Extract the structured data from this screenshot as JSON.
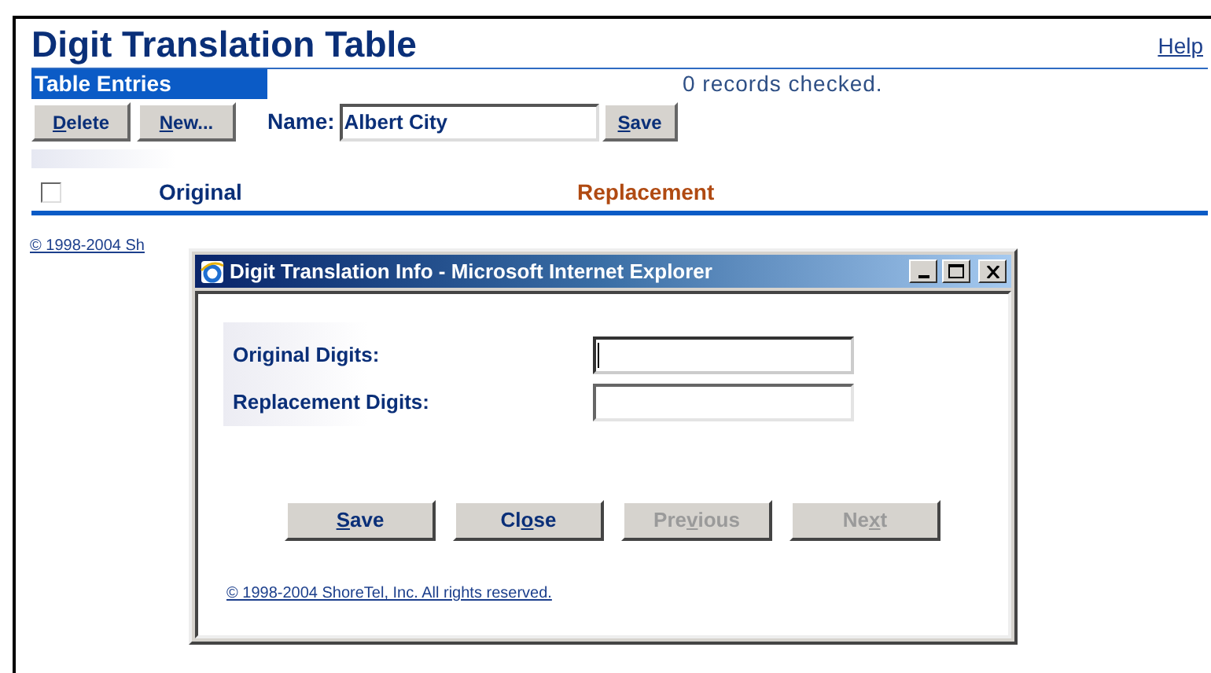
{
  "page": {
    "title": "Digit Translation Table",
    "help_link": "Help",
    "section_tab": "Table Entries",
    "records_status": "0 records checked.",
    "toolbar_buttons": [
      {
        "key": "D",
        "after": "elete"
      },
      {
        "key": "N",
        "after": "ew..."
      }
    ],
    "name_label": "Name:",
    "name_value": "Albert City",
    "save_button": {
      "key": "S",
      "after": "ave"
    },
    "columns": [
      {
        "label": "Original",
        "selected": false
      },
      {
        "label": "Replacement",
        "selected": true
      }
    ],
    "select_all_checked": false,
    "copyright": "© 1998-2004 Sh"
  },
  "dialog": {
    "title": "Digit Translation Info - Microsoft Internet Explorer",
    "fields": [
      {
        "label": "Original Digits:",
        "focused": true
      },
      {
        "label": "Replacement Digits:",
        "focused": false
      }
    ],
    "buttons": [
      {
        "key": "S",
        "after": "ave",
        "disabled": false
      },
      {
        "before": "Cl",
        "key": "o",
        "after": "se",
        "disabled": false
      },
      {
        "before": "Pre",
        "key": "v",
        "after": "ious",
        "disabled": true
      },
      {
        "before": "Ne",
        "key": "x",
        "after": "t",
        "disabled": true
      }
    ],
    "copyright": "© 1998-2004 ShoreTel, Inc. All rights reserved."
  }
}
